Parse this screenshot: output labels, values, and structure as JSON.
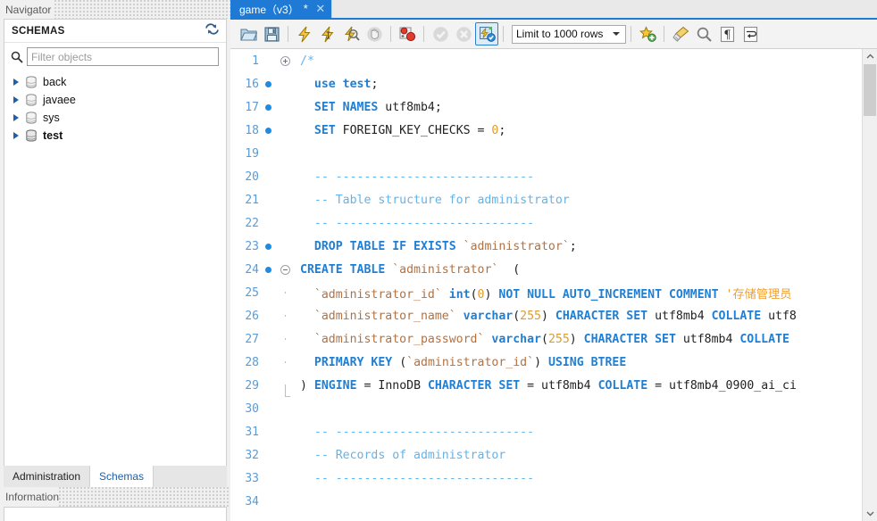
{
  "navigator": {
    "title": "Navigator",
    "schemas_label": "SCHEMAS",
    "refresh_icon": "refresh-icon",
    "search_icon": "search-icon",
    "filter_placeholder": "Filter objects",
    "filter_value": "",
    "schemas": [
      {
        "name": "back",
        "bold": false
      },
      {
        "name": "javaee",
        "bold": false
      },
      {
        "name": "sys",
        "bold": false
      },
      {
        "name": "test",
        "bold": true
      }
    ],
    "bottom_tabs": [
      {
        "label": "Administration",
        "active": false
      },
      {
        "label": "Schemas",
        "active": true
      }
    ],
    "information_label": "Information"
  },
  "editor": {
    "tab": {
      "title": "game（v3）",
      "modified_marker": "*",
      "close_icon": "close-icon"
    },
    "toolbar": {
      "buttons": [
        {
          "name": "open-sql-file-icon",
          "title": "Open a SQL script file"
        },
        {
          "name": "save-sql-file-icon",
          "title": "Save script to file"
        },
        {
          "name": "execute-statements-icon",
          "title": "Execute"
        },
        {
          "name": "execute-current-statement-icon",
          "title": "Execute current statement"
        },
        {
          "name": "explain-statement-icon",
          "title": "Explain current statement"
        },
        {
          "name": "stop-execution-icon",
          "title": "Stop"
        },
        {
          "name": "toggle-breakpoint-icon",
          "title": "Toggle breakpoint"
        },
        {
          "name": "commit-icon",
          "title": "Commit"
        },
        {
          "name": "rollback-icon",
          "title": "Rollback"
        },
        {
          "name": "toggle-autocommit-icon",
          "title": "Toggle auto-commit"
        },
        {
          "name": "beautify-query-icon",
          "title": "Beautify SQL"
        },
        {
          "name": "clear-query-icon",
          "title": "Clear query area"
        },
        {
          "name": "find-icon",
          "title": "Find"
        },
        {
          "name": "toggle-invisible-chars-icon",
          "title": "Toggle invisible characters"
        },
        {
          "name": "toggle-wordwrap-icon",
          "title": "Toggle word wrapping"
        }
      ],
      "limit_label": "Limit to 1000 rows"
    },
    "lines": [
      {
        "num": "1",
        "dot": false,
        "fold": "plus",
        "tokens": [
          {
            "t": "cmt",
            "v": "/*"
          }
        ]
      },
      {
        "num": "16",
        "dot": true,
        "fold": "",
        "tokens": [
          {
            "t": "pln",
            "v": "  "
          },
          {
            "t": "kw",
            "v": "use"
          },
          {
            "t": "pln",
            "v": " "
          },
          {
            "t": "kw",
            "v": "test"
          },
          {
            "t": "op",
            "v": ";"
          }
        ]
      },
      {
        "num": "17",
        "dot": true,
        "fold": "",
        "tokens": [
          {
            "t": "pln",
            "v": "  "
          },
          {
            "t": "kw",
            "v": "SET NAMES"
          },
          {
            "t": "pln",
            "v": " utf8mb4"
          },
          {
            "t": "op",
            "v": ";"
          }
        ]
      },
      {
        "num": "18",
        "dot": true,
        "fold": "",
        "tokens": [
          {
            "t": "pln",
            "v": "  "
          },
          {
            "t": "kw",
            "v": "SET"
          },
          {
            "t": "pln",
            "v": " FOREIGN_KEY_CHECKS "
          },
          {
            "t": "op",
            "v": "= "
          },
          {
            "t": "num",
            "v": "0"
          },
          {
            "t": "op",
            "v": ";"
          }
        ]
      },
      {
        "num": "19",
        "dot": false,
        "fold": "",
        "tokens": []
      },
      {
        "num": "20",
        "dot": false,
        "fold": "",
        "tokens": [
          {
            "t": "cmt",
            "v": "  -- ----------------------------"
          }
        ]
      },
      {
        "num": "21",
        "dot": false,
        "fold": "",
        "tokens": [
          {
            "t": "cmt",
            "v": "  -- Table structure for administrator"
          }
        ]
      },
      {
        "num": "22",
        "dot": false,
        "fold": "",
        "tokens": [
          {
            "t": "cmt",
            "v": "  -- ----------------------------"
          }
        ]
      },
      {
        "num": "23",
        "dot": true,
        "fold": "",
        "tokens": [
          {
            "t": "pln",
            "v": "  "
          },
          {
            "t": "kw",
            "v": "DROP TABLE IF EXISTS"
          },
          {
            "t": "pln",
            "v": " "
          },
          {
            "t": "id",
            "v": "`administrator`"
          },
          {
            "t": "op",
            "v": ";"
          }
        ]
      },
      {
        "num": "24",
        "dot": true,
        "fold": "minus",
        "tokens": [
          {
            "t": "kw",
            "v": "CREATE TABLE"
          },
          {
            "t": "pln",
            "v": " "
          },
          {
            "t": "id",
            "v": "`administrator`"
          },
          {
            "t": "pln",
            "v": "  "
          },
          {
            "t": "op",
            "v": "("
          }
        ]
      },
      {
        "num": "25",
        "dot": false,
        "fold": "bar",
        "tokens": [
          {
            "t": "pln",
            "v": "  "
          },
          {
            "t": "id",
            "v": "`administrator_id`"
          },
          {
            "t": "pln",
            "v": " "
          },
          {
            "t": "kw",
            "v": "int"
          },
          {
            "t": "op",
            "v": "("
          },
          {
            "t": "num",
            "v": "0"
          },
          {
            "t": "op",
            "v": ")"
          },
          {
            "t": "pln",
            "v": " "
          },
          {
            "t": "kw",
            "v": "NOT NULL AUTO_INCREMENT COMMENT"
          },
          {
            "t": "pln",
            "v": " "
          },
          {
            "t": "str",
            "v": "'存储管理员"
          }
        ]
      },
      {
        "num": "26",
        "dot": false,
        "fold": "bar",
        "tokens": [
          {
            "t": "pln",
            "v": "  "
          },
          {
            "t": "id",
            "v": "`administrator_name`"
          },
          {
            "t": "pln",
            "v": " "
          },
          {
            "t": "kw",
            "v": "varchar"
          },
          {
            "t": "op",
            "v": "("
          },
          {
            "t": "num",
            "v": "255"
          },
          {
            "t": "op",
            "v": ")"
          },
          {
            "t": "pln",
            "v": " "
          },
          {
            "t": "kw",
            "v": "CHARACTER SET"
          },
          {
            "t": "pln",
            "v": " utf8mb4 "
          },
          {
            "t": "kw",
            "v": "COLLATE"
          },
          {
            "t": "pln",
            "v": " utf8"
          }
        ]
      },
      {
        "num": "27",
        "dot": false,
        "fold": "bar",
        "tokens": [
          {
            "t": "pln",
            "v": "  "
          },
          {
            "t": "id",
            "v": "`administrator_password`"
          },
          {
            "t": "pln",
            "v": " "
          },
          {
            "t": "kw",
            "v": "varchar"
          },
          {
            "t": "op",
            "v": "("
          },
          {
            "t": "num",
            "v": "255"
          },
          {
            "t": "op",
            "v": ")"
          },
          {
            "t": "pln",
            "v": " "
          },
          {
            "t": "kw",
            "v": "CHARACTER SET"
          },
          {
            "t": "pln",
            "v": " utf8mb4 "
          },
          {
            "t": "kw",
            "v": "COLLATE"
          }
        ]
      },
      {
        "num": "28",
        "dot": false,
        "fold": "bar",
        "tokens": [
          {
            "t": "pln",
            "v": "  "
          },
          {
            "t": "kw",
            "v": "PRIMARY KEY"
          },
          {
            "t": "pln",
            "v": " "
          },
          {
            "t": "op",
            "v": "("
          },
          {
            "t": "id",
            "v": "`administrator_id`"
          },
          {
            "t": "op",
            "v": ")"
          },
          {
            "t": "pln",
            "v": " "
          },
          {
            "t": "kw",
            "v": "USING BTREE"
          }
        ]
      },
      {
        "num": "29",
        "dot": false,
        "fold": "end",
        "tokens": [
          {
            "t": "op",
            "v": ")"
          },
          {
            "t": "pln",
            "v": " "
          },
          {
            "t": "kw",
            "v": "ENGINE"
          },
          {
            "t": "pln",
            "v": " "
          },
          {
            "t": "op",
            "v": "="
          },
          {
            "t": "pln",
            "v": " InnoDB "
          },
          {
            "t": "kw",
            "v": "CHARACTER SET"
          },
          {
            "t": "pln",
            "v": " "
          },
          {
            "t": "op",
            "v": "="
          },
          {
            "t": "pln",
            "v": " utf8mb4 "
          },
          {
            "t": "kw",
            "v": "COLLATE"
          },
          {
            "t": "pln",
            "v": " "
          },
          {
            "t": "op",
            "v": "="
          },
          {
            "t": "pln",
            "v": " utf8mb4_0900_ai_ci"
          }
        ]
      },
      {
        "num": "30",
        "dot": false,
        "fold": "",
        "tokens": []
      },
      {
        "num": "31",
        "dot": false,
        "fold": "",
        "tokens": [
          {
            "t": "cmt",
            "v": "  -- ----------------------------"
          }
        ]
      },
      {
        "num": "32",
        "dot": false,
        "fold": "",
        "tokens": [
          {
            "t": "cmt",
            "v": "  -- Records of administrator"
          }
        ]
      },
      {
        "num": "33",
        "dot": false,
        "fold": "",
        "tokens": [
          {
            "t": "cmt",
            "v": "  -- ----------------------------"
          }
        ]
      },
      {
        "num": "34",
        "dot": false,
        "fold": "",
        "tokens": []
      }
    ],
    "scrollbar": {
      "up_icon": "chevron-up-icon",
      "down_icon": "chevron-down-icon"
    }
  },
  "colors": {
    "tab_active": "#1e7ad4",
    "keyword": "#1f7fd4",
    "identifier": "#b4713f",
    "comment": "#63b3ea",
    "number": "#e09b2b",
    "string": "#f0a030"
  }
}
